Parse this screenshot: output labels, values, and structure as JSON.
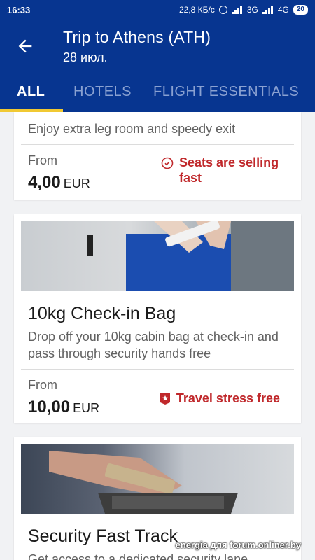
{
  "status": {
    "time": "16:33",
    "speed": "22,8 КБ/с",
    "net1": "3G",
    "net2": "4G",
    "battery": "20"
  },
  "header": {
    "title": "Trip to Athens (ATH)",
    "date": "28 июл.",
    "back_icon": "arrow-left-icon"
  },
  "tabs": [
    {
      "label": "ALL",
      "active": true
    },
    {
      "label": "HOTELS",
      "active": false
    },
    {
      "label": "FLIGHT ESSENTIALS",
      "active": false
    }
  ],
  "cards": [
    {
      "desc": "Enjoy extra leg room and speedy exit",
      "from": "From",
      "price": "4,00",
      "currency": "EUR",
      "badge": "Seats are selling fast",
      "badge_icon": "clock-icon"
    },
    {
      "title": "10kg Check-in Bag",
      "desc": "Drop off your 10kg cabin bag at check-in and pass through security hands free",
      "from": "From",
      "price": "10,00",
      "currency": "EUR",
      "badge": "Travel stress free",
      "badge_icon": "star-badge-icon"
    },
    {
      "title": "Security Fast Track",
      "desc": "Get access to a dedicated security lane"
    }
  ],
  "watermark": "energia для forum.onliner.by",
  "colors": {
    "primary": "#073590",
    "accent": "#f1c933",
    "badge_red": "#c0282b"
  }
}
